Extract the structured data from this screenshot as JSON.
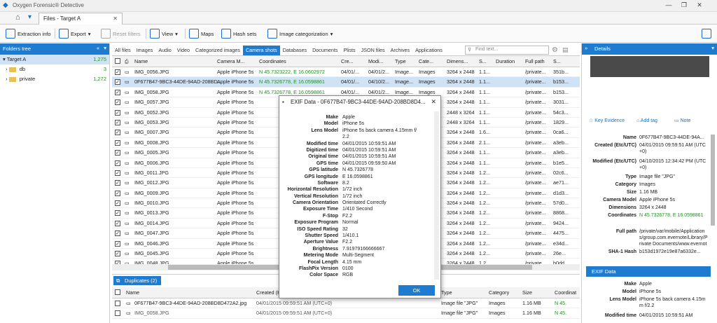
{
  "app": {
    "title": "Oxygen Forensic® Detective"
  },
  "tabs": [
    {
      "label": "Files - Target A"
    }
  ],
  "toolbar": {
    "extraction_info": "Extraction info",
    "export": "Export",
    "reset_filters": "Reset filters",
    "view": "View",
    "maps": "Maps",
    "hash_sets": "Hash sets",
    "image_categorization": "Image categorization"
  },
  "folders_tree": {
    "title": "Folders tree",
    "items": [
      {
        "label": "Target A",
        "count": "1,275"
      },
      {
        "label": "db",
        "count": "3"
      },
      {
        "label": "private",
        "count": "1,272"
      }
    ]
  },
  "filters": [
    "All files",
    "Images",
    "Audio",
    "Video",
    "Categorized images",
    "Camera shots",
    "Databases",
    "Documents",
    "Plists",
    "JSON files",
    "Archives",
    "Applications"
  ],
  "find_placeholder": "Find text...",
  "grid": {
    "headers": [
      "Name",
      "Camera M...",
      "Coordinates",
      "Cre...",
      "Modi...",
      "Type",
      "Cate...",
      "Dimens...",
      "S...",
      "Duration",
      "Full path",
      "S..."
    ],
    "rows": [
      {
        "name": "IMG_0056.JPG",
        "camera": "Apple iPhone 5s",
        "coords": "N 45.7323222, E 16.0602972",
        "created": "04/01/...",
        "modified": "04/01/2...",
        "type": "Image...",
        "cat": "Images",
        "dim": "3264 x 2448",
        "s": "1.1...",
        "path": "/private...",
        "hash": "351b..."
      },
      {
        "name": "0F677B47-9BC3-44DE-94AD-208BD...",
        "camera": "Apple iPhone 5s",
        "coords": "N 45.7326778, E 16.0598861",
        "created": "04/01/...",
        "modified": "04/10/2...",
        "type": "Image...",
        "cat": "Images",
        "dim": "3264 x 2448",
        "s": "1.1...",
        "path": "/private...",
        "hash": "b153..."
      },
      {
        "name": "IMG_0058.JPG",
        "camera": "Apple iPhone 5s",
        "coords": "N 45.7326778, E 16.0598861",
        "created": "04/01/...",
        "modified": "04/01/2...",
        "type": "Image...",
        "cat": "Images",
        "dim": "3264 x 2448",
        "s": "1.1...",
        "path": "/private...",
        "hash": "b153..."
      },
      {
        "name": "IMG_0057.JPG",
        "camera": "Apple iPhone 5s",
        "coords": "",
        "created": "",
        "modified": "",
        "type": "",
        "cat": "",
        "dim": "3264 x 2448",
        "s": "1.1...",
        "path": "/private...",
        "hash": "3031..."
      },
      {
        "name": "IMG_0052.JPG",
        "camera": "Apple iPhone 5s",
        "coords": "",
        "created": "",
        "modified": "",
        "type": "",
        "cat": "",
        "dim": "2448 x 3264",
        "s": "1.1...",
        "path": "/private...",
        "hash": "54c3..."
      },
      {
        "name": "IMG_0053.JPG",
        "camera": "Apple iPhone 5s",
        "coords": "",
        "created": "",
        "modified": "",
        "type": "",
        "cat": "",
        "dim": "2448 x 3264",
        "s": "1.1...",
        "path": "/private...",
        "hash": "1829..."
      },
      {
        "name": "IMG_0007.JPG",
        "camera": "Apple iPhone 5s",
        "coords": "",
        "created": "",
        "modified": "",
        "type": "",
        "cat": "",
        "dim": "3264 x 2448",
        "s": "1.6...",
        "path": "/private...",
        "hash": "0ca6..."
      },
      {
        "name": "IMG_0008.JPG",
        "camera": "Apple iPhone 5s",
        "coords": "",
        "created": "",
        "modified": "",
        "type": "",
        "cat": "",
        "dim": "3264 x 2448",
        "s": "2.1...",
        "path": "/private...",
        "hash": "a3eb..."
      },
      {
        "name": "IMG_0005.JPG",
        "camera": "Apple iPhone 5s",
        "coords": "",
        "created": "",
        "modified": "",
        "type": "",
        "cat": "",
        "dim": "3264 x 2448",
        "s": "1.1...",
        "path": "/private...",
        "hash": "a3eb..."
      },
      {
        "name": "IMG_0006.JPG",
        "camera": "Apple iPhone 5s",
        "coords": "",
        "created": "",
        "modified": "",
        "type": "",
        "cat": "",
        "dim": "3264 x 2448",
        "s": "1.1...",
        "path": "/private...",
        "hash": "b1e5..."
      },
      {
        "name": "IMG_0011.JPG",
        "camera": "Apple iPhone 5s",
        "coords": "",
        "created": "",
        "modified": "",
        "type": "",
        "cat": "",
        "dim": "3264 x 2448",
        "s": "1.2...",
        "path": "/private...",
        "hash": "02c6..."
      },
      {
        "name": "IMG_0012.JPG",
        "camera": "Apple iPhone 5s",
        "coords": "",
        "created": "",
        "modified": "",
        "type": "",
        "cat": "",
        "dim": "3264 x 2448",
        "s": "1.2...",
        "path": "/private...",
        "hash": "ae71..."
      },
      {
        "name": "IMG_0009.JPG",
        "camera": "Apple iPhone 5s",
        "coords": "",
        "created": "",
        "modified": "",
        "type": "",
        "cat": "",
        "dim": "3264 x 2448",
        "s": "1.2...",
        "path": "/private...",
        "hash": "d1d3..."
      },
      {
        "name": "IMG_0010.JPG",
        "camera": "Apple iPhone 5s",
        "coords": "",
        "created": "",
        "modified": "",
        "type": "",
        "cat": "",
        "dim": "3264 x 2448",
        "s": "1.2...",
        "path": "/private...",
        "hash": "57d0..."
      },
      {
        "name": "IMG_0013.JPG",
        "camera": "Apple iPhone 5s",
        "coords": "",
        "created": "",
        "modified": "",
        "type": "",
        "cat": "",
        "dim": "3264 x 2448",
        "s": "1.2...",
        "path": "/private...",
        "hash": "8868..."
      },
      {
        "name": "IMG_0014.JPG",
        "camera": "Apple iPhone 5s",
        "coords": "",
        "created": "",
        "modified": "",
        "type": "",
        "cat": "",
        "dim": "3264 x 2448",
        "s": "1.2...",
        "path": "/private...",
        "hash": "9424..."
      },
      {
        "name": "IMG_0047.JPG",
        "camera": "Apple iPhone 5s",
        "coords": "",
        "created": "",
        "modified": "",
        "type": "",
        "cat": "",
        "dim": "3264 x 2448",
        "s": "1.2...",
        "path": "/private...",
        "hash": "4475..."
      },
      {
        "name": "IMG_0046.JPG",
        "camera": "Apple iPhone 5s",
        "coords": "",
        "created": "",
        "modified": "",
        "type": "",
        "cat": "",
        "dim": "3264 x 2448",
        "s": "1.2...",
        "path": "/private...",
        "hash": "e34d..."
      },
      {
        "name": "IMG_0045.JPG",
        "camera": "Apple iPhone 5s",
        "coords": "",
        "created": "",
        "modified": "",
        "type": "",
        "cat": "",
        "dim": "3264 x 2448",
        "s": "1.2...",
        "path": "/private...",
        "hash": "26e..."
      },
      {
        "name": "IMG_0048.JPG",
        "camera": "Apple iPhone 5s",
        "coords": "",
        "created": "",
        "modified": "",
        "type": "",
        "cat": "",
        "dim": "3264 x 2448",
        "s": "1.2...",
        "path": "/private...",
        "hash": "b0dd..."
      }
    ]
  },
  "exif_dialog": {
    "title": "EXIF Data - 0F677B47-9BC3-44DE-94AD-208BD8D4...",
    "ok": "OK",
    "fields": [
      {
        "k": "Make",
        "v": "Apple"
      },
      {
        "k": "Model",
        "v": "iPhone 5s"
      },
      {
        "k": "Lens Model",
        "v": "iPhone 5s back camera 4.15mm f/"
      },
      {
        "k": "",
        "v": "2.2"
      },
      {
        "k": "Modified time",
        "v": "04/01/2015 10:59:51 AM"
      },
      {
        "k": "Digitized time",
        "v": "04/01/2015 10:59:51 AM"
      },
      {
        "k": "Original time",
        "v": "04/01/2015 10:59:51 AM"
      },
      {
        "k": "GPS time",
        "v": "04/01/2015 09:59:50 AM"
      },
      {
        "k": "GPS latitude",
        "v": "N 45.7326778"
      },
      {
        "k": "GPS longitude",
        "v": "E 16.0598861"
      },
      {
        "k": "Software",
        "v": "8.2"
      },
      {
        "k": "Horizontal Resolution",
        "v": "1/72 inch"
      },
      {
        "k": "Vertical Resolution",
        "v": "1/72 inch"
      },
      {
        "k": "Camera Orientation",
        "v": "Orientated Correctly"
      },
      {
        "k": "Exposure Time",
        "v": "1/410 Second"
      },
      {
        "k": "F-Stop",
        "v": "F2.2"
      },
      {
        "k": "Exposure Program",
        "v": "Normal"
      },
      {
        "k": "ISO Speed Rating",
        "v": "32"
      },
      {
        "k": "Shutter Speed",
        "v": "1/410.1"
      },
      {
        "k": "Aperture Value",
        "v": "F2.2"
      },
      {
        "k": "Brightness",
        "v": "7.91979166666667"
      },
      {
        "k": "Metering Mode",
        "v": "Multi-Segment"
      },
      {
        "k": "Focal Length",
        "v": "4.15 mm"
      },
      {
        "k": "FlashPix Version",
        "v": "0100"
      },
      {
        "k": "Color Space",
        "v": "RGB"
      }
    ]
  },
  "duplicates": {
    "title": "Duplicates (2)",
    "headers": [
      "Name",
      "Created (E",
      "Type",
      "Category",
      "Size",
      "Coordinat"
    ],
    "rows": [
      {
        "name": "0F677B47-9BC3-44DE-94AD-208BD8D472A2.jpg",
        "created": "04/01/2015 09:59:51 AM (UTC+0)",
        "type": "Image file \"JPG\"",
        "cat": "Images",
        "size": "1.16 MB",
        "coord": "N 45."
      },
      {
        "name": "IMG_0058.JPG",
        "created": "04/01/2015 09:59:51 AM (UTC+0)",
        "type": "Image file \"JPG\"",
        "cat": "Images",
        "size": "1.16 MB",
        "coord": "N 45."
      }
    ]
  },
  "details": {
    "title": "Details",
    "key_evidence": "Key Evidence",
    "add_tag": "Add tag",
    "note": "Note",
    "name_k": "Name",
    "name_v": "0F677B47-9BC3-44DE-94A...",
    "created_k": "Created (Etc/UTC)",
    "created_v": "04/01/2015 09:59:51 AM (UTC+0)",
    "modified_k": "Modified (Etc/UTC)",
    "modified_v": "04/10/2015 12:34:42 PM (UTC+0)",
    "type_k": "Type",
    "type_v": "Image file \"JPG\"",
    "category_k": "Category",
    "category_v": "Images",
    "size_k": "Size",
    "size_v": "1.16 MB",
    "camera_k": "Camera Model",
    "camera_v": "Apple iPhone 5s",
    "dims_k": "Dimensions",
    "dims_v": "3264 x 2448",
    "coords_k": "Coordinates",
    "coords_v": "N 45.7326778, E 16.0598861",
    "path_k": "Full path",
    "path_v": "/private/var/mobile/Applications/group.com.evernote/Library/Private Documents/www.evernote.com/103158272/content/DBBB14A0-FE31-4605-9D0...0F677B47-9BC3-44DE-94A...",
    "sha_k": "SHA-1 Hash",
    "sha_v": "b153d1972e19e87a6332e...",
    "exif_title": "EXIF Data",
    "make_k": "Make",
    "make_v": "Apple",
    "model_k": "Model",
    "model_v": "iPhone 5s",
    "lens_k": "Lens Model",
    "lens_v": "iPhone 5s back camera 4.15mm f/2.2",
    "mtime_k": "Modified time",
    "mtime_v": "04/01/2015 10:59:51 AM"
  },
  "colors": {
    "accent": "#1e7bd0",
    "geo": "#2a8a2a"
  }
}
